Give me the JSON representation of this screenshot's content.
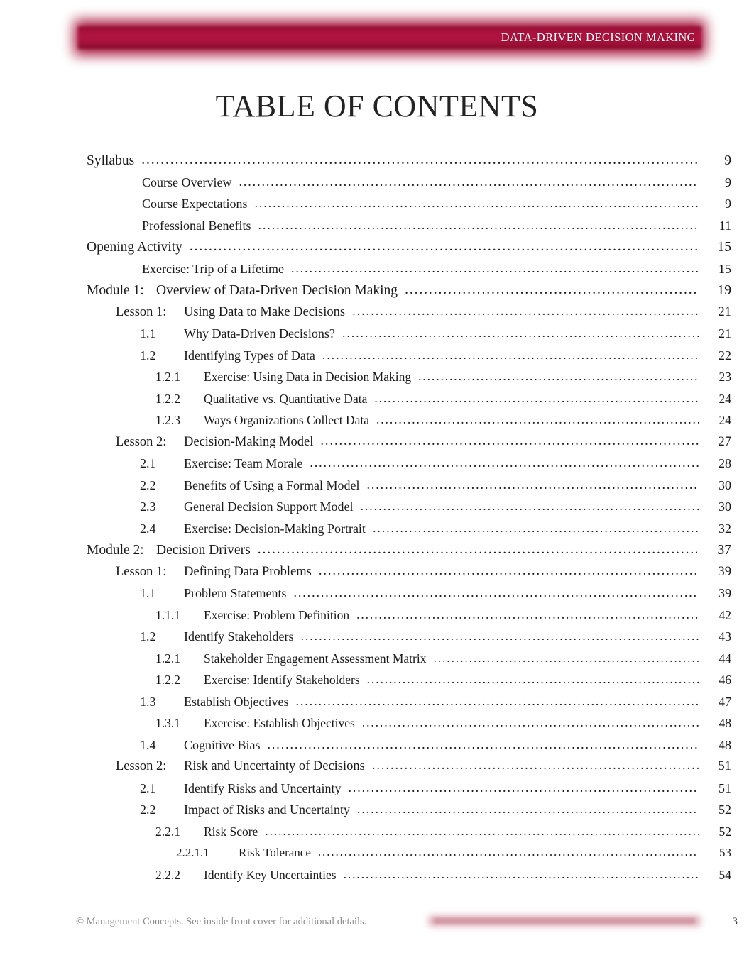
{
  "header": {
    "title": "DATA-DRIVEN DECISION MAKING",
    "band_color": "#a8143c"
  },
  "page_title": "TABLE OF CONTENTS",
  "toc": {
    "entries": [
      {
        "level": "top",
        "number": "",
        "text": "Syllabus",
        "page": "9"
      },
      {
        "level": "sub",
        "number": "",
        "text": "Course Overview",
        "page": "9"
      },
      {
        "level": "sub",
        "number": "",
        "text": "Course Expectations",
        "page": "9"
      },
      {
        "level": "sub",
        "number": "",
        "text": "Professional Benefits",
        "page": "11"
      },
      {
        "level": "top",
        "number": "",
        "text": "Opening Activity",
        "page": "15"
      },
      {
        "level": "sub",
        "number": "",
        "text": "Exercise: Trip of a Lifetime",
        "page": "15"
      },
      {
        "level": "mod",
        "number": "Module 1:",
        "text": "Overview of Data-Driven Decision Making",
        "page": "19"
      },
      {
        "level": "les",
        "number": "Lesson 1:",
        "text": "Using Data to Make Decisions",
        "page": "21"
      },
      {
        "level": "h1",
        "number": "1.1",
        "text": "Why Data-Driven Decisions?",
        "page": "21"
      },
      {
        "level": "h1",
        "number": "1.2",
        "text": "Identifying Types of Data",
        "page": "22"
      },
      {
        "level": "h2",
        "number": "1.2.1",
        "text": "Exercise: Using Data in Decision Making",
        "page": "23"
      },
      {
        "level": "h2",
        "number": "1.2.2",
        "text": "Qualitative vs. Quantitative Data",
        "page": "24"
      },
      {
        "level": "h2",
        "number": "1.2.3",
        "text": "Ways Organizations Collect Data",
        "page": "24"
      },
      {
        "level": "les",
        "number": "Lesson 2:",
        "text": "Decision-Making Model",
        "page": "27"
      },
      {
        "level": "h1",
        "number": "2.1",
        "text": "Exercise: Team Morale",
        "page": "28"
      },
      {
        "level": "h1",
        "number": "2.2",
        "text": "Benefits of Using a Formal Model",
        "page": "30"
      },
      {
        "level": "h1",
        "number": "2.3",
        "text": "General Decision Support Model",
        "page": "30"
      },
      {
        "level": "h1",
        "number": "2.4",
        "text": "Exercise: Decision-Making Portrait",
        "page": "32"
      },
      {
        "level": "mod",
        "number": "Module 2:",
        "text": "Decision Drivers",
        "page": "37"
      },
      {
        "level": "les",
        "number": "Lesson 1:",
        "text": "Defining Data Problems",
        "page": "39"
      },
      {
        "level": "h1",
        "number": "1.1",
        "text": "Problem Statements",
        "page": "39"
      },
      {
        "level": "h2",
        "number": "1.1.1",
        "text": "Exercise: Problem Definition",
        "page": "42"
      },
      {
        "level": "h1",
        "number": "1.2",
        "text": "Identify Stakeholders",
        "page": "43"
      },
      {
        "level": "h2",
        "number": "1.2.1",
        "text": "Stakeholder Engagement Assessment Matrix",
        "page": "44"
      },
      {
        "level": "h2",
        "number": "1.2.2",
        "text": "Exercise: Identify Stakeholders",
        "page": "46"
      },
      {
        "level": "h1",
        "number": "1.3",
        "text": "Establish Objectives",
        "page": "47"
      },
      {
        "level": "h2",
        "number": "1.3.1",
        "text": "Exercise: Establish Objectives",
        "page": "48"
      },
      {
        "level": "h1",
        "number": "1.4",
        "text": "Cognitive Bias",
        "page": "48"
      },
      {
        "level": "les",
        "number": "Lesson 2:",
        "text": "Risk and Uncertainty of Decisions",
        "page": "51"
      },
      {
        "level": "h1",
        "number": "2.1",
        "text": "Identify Risks and Uncertainty",
        "page": "51"
      },
      {
        "level": "h1",
        "number": "2.2",
        "text": "Impact of Risks and Uncertainty",
        "page": "52"
      },
      {
        "level": "h2",
        "number": "2.2.1",
        "text": "Risk Score",
        "page": "52"
      },
      {
        "level": "h3",
        "number": "2.2.1.1",
        "text": "Risk Tolerance",
        "page": "53"
      },
      {
        "level": "h2",
        "number": "2.2.2",
        "text": "Identify Key Uncertainties",
        "page": "54"
      }
    ]
  },
  "footer": {
    "copyright": "© Management Concepts. See inside front cover for additional details.",
    "page_number": "3",
    "band_color": "#d49aa6"
  }
}
